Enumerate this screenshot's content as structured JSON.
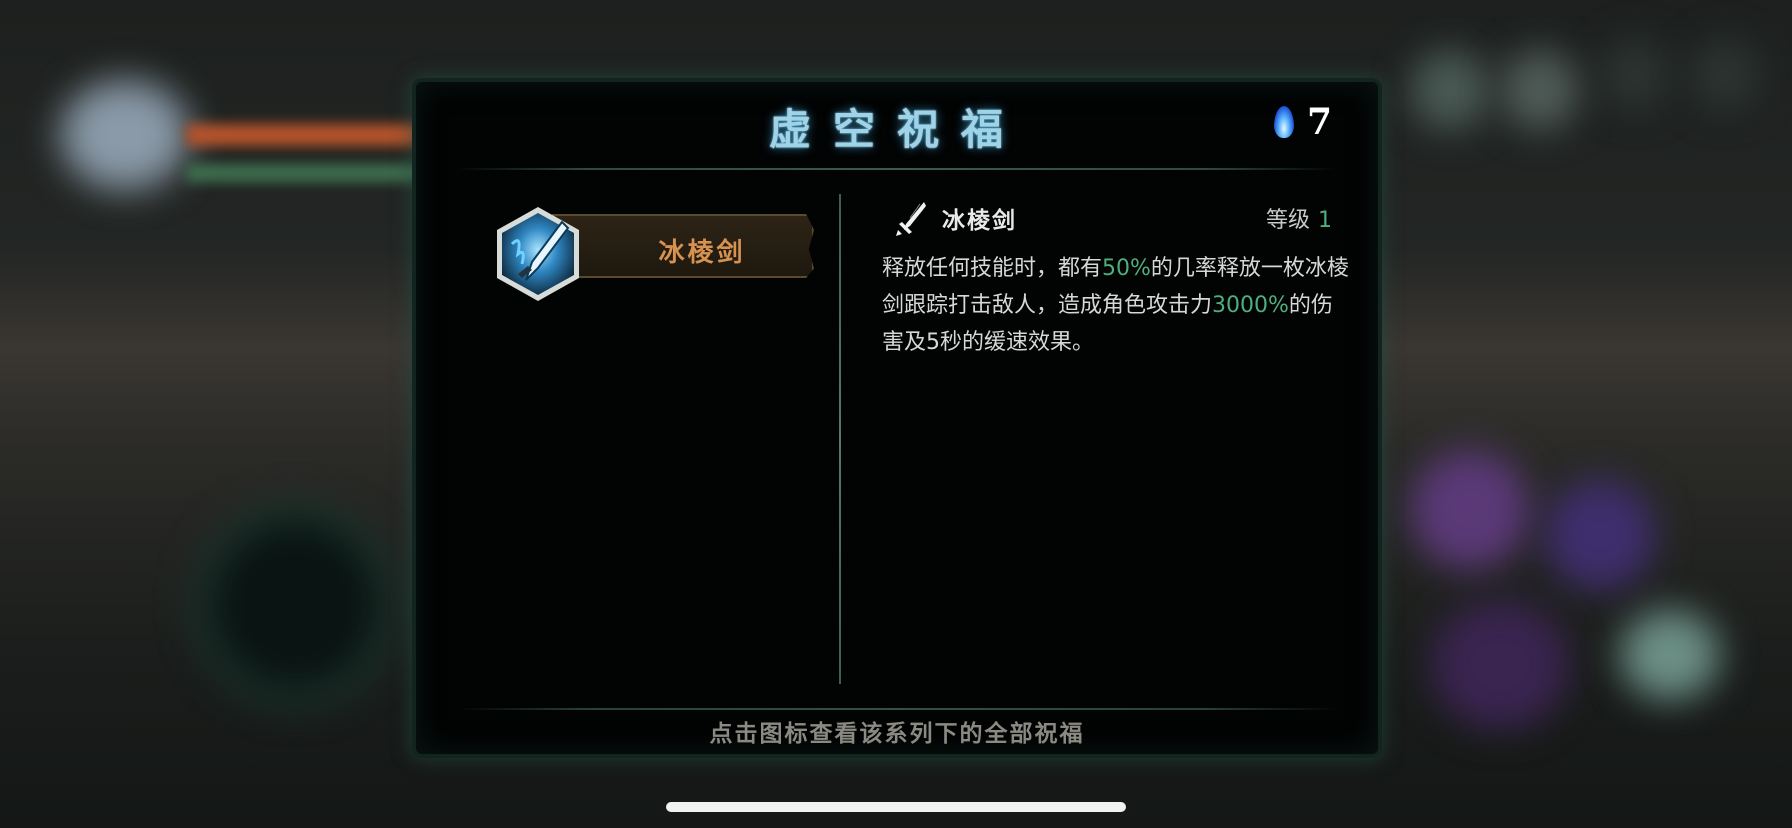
{
  "modal": {
    "title": "虚空祝福",
    "currency_icon": "blue-flame-icon",
    "currency_count": "7",
    "hint": "点击图标查看该系列下的全部祝福"
  },
  "blessing_list": [
    {
      "name": "冰棱剑",
      "icon": "ice-sword-icon"
    }
  ],
  "detail": {
    "name": "冰棱剑",
    "icon": "sword-icon",
    "level_label": "等级",
    "level_value": "1",
    "description": {
      "p1": "释放任何技能时，都有",
      "v1": "50%",
      "p2": "的几率释放一枚冰棱剑跟踪打击敌人，造成角色攻击力",
      "v2": "3000%",
      "p3": "的伤害及5秒的缓速效果。"
    }
  },
  "colors": {
    "highlight": "#4fae7f",
    "title": "#9fd3e8",
    "skill_name": "#d7924f"
  }
}
